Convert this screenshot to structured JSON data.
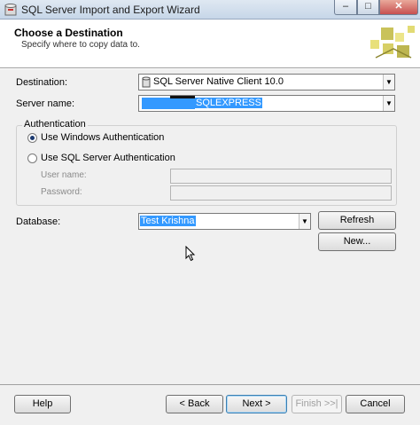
{
  "window": {
    "title": "SQL Server Import and Export Wizard",
    "min_glyph": "–",
    "max_glyph": "□",
    "close_glyph": "✕"
  },
  "header": {
    "title": "Choose a Destination",
    "subtitle": "Specify where to copy data to."
  },
  "destination": {
    "label": "Destination:",
    "value": "SQL Server Native Client 10.0"
  },
  "server": {
    "label": "Server name:",
    "value_suffix": "SQLEXPRESS"
  },
  "auth": {
    "legend": "Authentication",
    "windows_label": "Use Windows Authentication",
    "sql_label": "Use SQL Server Authentication",
    "selected": "windows",
    "user_label": "User name:",
    "password_label": "Password:"
  },
  "database": {
    "label": "Database:",
    "value": "Test Krishna",
    "refresh_label": "Refresh",
    "new_label": "New..."
  },
  "footer": {
    "help": "Help",
    "back": "< Back",
    "next": "Next >",
    "finish": "Finish >>|",
    "cancel": "Cancel"
  },
  "icons": {
    "dropdown": "▼"
  }
}
